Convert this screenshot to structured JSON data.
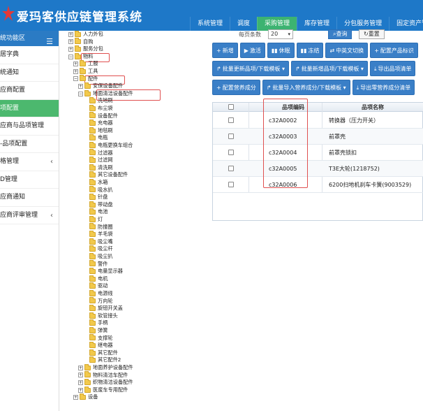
{
  "header": {
    "app_title": "爱玛客供应链管理系统",
    "nav": [
      {
        "label": "系统管理",
        "active": false
      },
      {
        "label": "调度",
        "active": false
      },
      {
        "label": "采购管理",
        "active": true
      },
      {
        "label": "库存管理",
        "active": false
      },
      {
        "label": "分包服务管理",
        "active": false
      },
      {
        "label": "固定资产管理",
        "active": false
      }
    ]
  },
  "sidebar": {
    "head": "统功能区",
    "items": [
      {
        "label": "居字典",
        "active": false,
        "arrow": ""
      },
      {
        "label": "统通知",
        "active": false,
        "arrow": ""
      },
      {
        "label": "应商配置",
        "active": false,
        "arrow": ""
      },
      {
        "label": "项配置",
        "active": true,
        "arrow": ""
      },
      {
        "label": "应商与品项管理",
        "active": false,
        "arrow": ""
      },
      {
        "label": "-品项配置",
        "active": false,
        "arrow": ""
      },
      {
        "label": "格管理",
        "active": false,
        "arrow": "‹"
      },
      {
        "label": "D管理",
        "active": false,
        "arrow": ""
      },
      {
        "label": "应商通知",
        "active": false,
        "arrow": ""
      },
      {
        "label": "应商评审管理",
        "active": false,
        "arrow": "‹"
      }
    ]
  },
  "tree": [
    {
      "label": "人力外包",
      "toggle": "+"
    },
    {
      "label": "自购",
      "toggle": "+"
    },
    {
      "label": "服务分包",
      "toggle": "+"
    },
    {
      "label": "物料",
      "toggle": "−"
    },
    {
      "label": "工服",
      "toggle": "+"
    },
    {
      "label": "工具",
      "toggle": "+"
    },
    {
      "label": "配件",
      "toggle": "−"
    },
    {
      "label": "安保设备配件",
      "toggle": "+"
    },
    {
      "label": "地面清洁设备配件",
      "toggle": "−"
    },
    {
      "label": "洗地刷",
      "toggle": ""
    },
    {
      "label": "布尘袋",
      "toggle": ""
    },
    {
      "label": "设备配件",
      "toggle": ""
    },
    {
      "label": "充电器",
      "toggle": ""
    },
    {
      "label": "地毯刷",
      "toggle": ""
    },
    {
      "label": "电瓶",
      "toggle": ""
    },
    {
      "label": "电瓶更换车组合",
      "toggle": ""
    },
    {
      "label": "过滤器",
      "toggle": ""
    },
    {
      "label": "过滤网",
      "toggle": ""
    },
    {
      "label": "清洗刷",
      "toggle": ""
    },
    {
      "label": "其它设备配件",
      "toggle": ""
    },
    {
      "label": "水箱",
      "toggle": ""
    },
    {
      "label": "吸水扒",
      "toggle": ""
    },
    {
      "label": "针盘",
      "toggle": ""
    },
    {
      "label": "带动盘",
      "toggle": ""
    },
    {
      "label": "电池",
      "toggle": ""
    },
    {
      "label": "灯",
      "toggle": ""
    },
    {
      "label": "防撞圈",
      "toggle": ""
    },
    {
      "label": "羊毛袋",
      "toggle": ""
    },
    {
      "label": "吸尘嘴",
      "toggle": ""
    },
    {
      "label": "吸尘杆",
      "toggle": ""
    },
    {
      "label": "吸尘扒",
      "toggle": ""
    },
    {
      "label": "警件",
      "toggle": ""
    },
    {
      "label": "电量显示器",
      "toggle": ""
    },
    {
      "label": "电机",
      "toggle": ""
    },
    {
      "label": "驱动",
      "toggle": ""
    },
    {
      "label": "电源线",
      "toggle": ""
    },
    {
      "label": "万向轮",
      "toggle": ""
    },
    {
      "label": "旋钮开关盖",
      "toggle": ""
    },
    {
      "label": "软管接头",
      "toggle": ""
    },
    {
      "label": "手柄",
      "toggle": ""
    },
    {
      "label": "弹簧",
      "toggle": ""
    },
    {
      "label": "支撑轮",
      "toggle": ""
    },
    {
      "label": "继电器",
      "toggle": ""
    },
    {
      "label": "其它配件",
      "toggle": ""
    },
    {
      "label": "其它配件2",
      "toggle": ""
    },
    {
      "label": "地面养护设备配件",
      "toggle": "+"
    },
    {
      "label": "物料清洁车配件",
      "toggle": "+"
    },
    {
      "label": "织物清洁设备配件",
      "toggle": "+"
    },
    {
      "label": "医废车专用配件",
      "toggle": "+"
    },
    {
      "label": "设备",
      "toggle": "+"
    }
  ],
  "main": {
    "page_size_label": "每页条数",
    "page_size_value": "20",
    "search_label": "查询",
    "reset_label": "重置",
    "toolbar_row1": [
      {
        "icon": "+",
        "label": "新增"
      },
      {
        "icon": "▶",
        "label": "激活"
      },
      {
        "icon": "▮▮",
        "label": "休眠"
      },
      {
        "icon": "▮▮",
        "label": "冻结"
      },
      {
        "icon": "⇄",
        "label": "中英文切换"
      },
      {
        "icon": "+",
        "label": "配置产品标识"
      }
    ],
    "toolbar_row2": [
      {
        "icon": "↱",
        "label": "批量更新品项/下载模板 ▾"
      },
      {
        "icon": "↱",
        "label": "批量新增品项/下载模板 ▾"
      },
      {
        "icon": "⤓",
        "label": "导出品项清单"
      }
    ],
    "toolbar_row3": [
      {
        "icon": "+",
        "label": "配置营养成分"
      },
      {
        "icon": "↱",
        "label": "批量导入营养成分/下载模板 ▾"
      },
      {
        "icon": "⤓",
        "label": "导出零营养成分清单"
      }
    ],
    "grid": {
      "columns": [
        "品项编码",
        "品项名称"
      ],
      "rows": [
        {
          "code": "c32A0002",
          "name": "转换器（压力开关）"
        },
        {
          "code": "c32A0003",
          "name": "前罩壳"
        },
        {
          "code": "c32A0004",
          "name": "前罩壳锁扣"
        },
        {
          "code": "c32A0005",
          "name": "T3E大轮(1218752)"
        },
        {
          "code": "c32A0006",
          "name": "6200扫地机刹车卡簧(9003529)"
        }
      ]
    }
  }
}
